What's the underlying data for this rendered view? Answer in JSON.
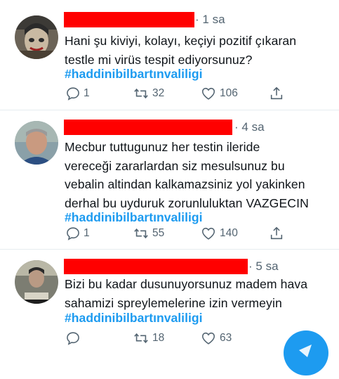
{
  "tweets": [
    {
      "time": "1 sa",
      "lines": [
        "Hani şu kiviyi, kolayı, keçiyi pozitif çıkaran",
        "testle mi virüs tespit ediyorsunuz?"
      ],
      "hashtag": "#haddinibilbartınvaliligi",
      "replies": "1",
      "retweets": "32",
      "likes": "106"
    },
    {
      "time": "4 sa",
      "lines": [
        "Mecbur tuttugunuz her testin ileride",
        "vereceği zararlardan siz mesulsunuz bu",
        "vebalin altindan kalkamazsiniz yol yakinken",
        "derhal bu uyduruk zorunluluktan VAZGECIN"
      ],
      "hashtag": "#haddinibilbartınvaliligi",
      "replies": "1",
      "retweets": "55",
      "likes": "140"
    },
    {
      "time": "5 sa",
      "lines": [
        "Bizi bu kadar dusunuyorsunuz madem hava",
        "sahamizi spreylemelerine izin vermeyin"
      ],
      "hashtag": "#haddinibilbartınvaliligi",
      "replies": "",
      "retweets": "18",
      "likes": "63"
    }
  ],
  "colors": {
    "accent": "#1d9bf0",
    "redaction": "#ff0000",
    "muted": "#536471",
    "divider": "#e6ecf0"
  },
  "icons": [
    "reply-icon",
    "retweet-icon",
    "like-icon",
    "share-icon",
    "compose-icon"
  ]
}
